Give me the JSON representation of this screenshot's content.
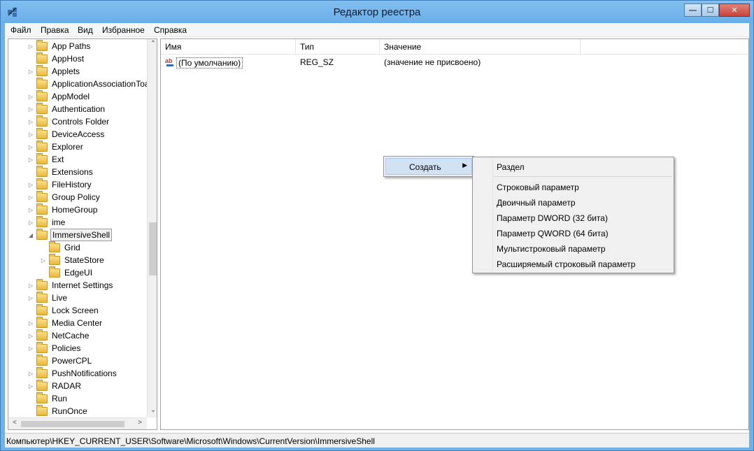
{
  "window": {
    "title": "Редактор реестра",
    "min_glyph": "—",
    "max_glyph": "☐",
    "close_glyph": "✕"
  },
  "menu": [
    "Файл",
    "Правка",
    "Вид",
    "Избранное",
    "Справка"
  ],
  "tree": {
    "items": [
      {
        "label": "App Paths",
        "expander": "▷",
        "level": 0
      },
      {
        "label": "AppHost",
        "expander": "",
        "level": 0
      },
      {
        "label": "Applets",
        "expander": "▷",
        "level": 0
      },
      {
        "label": "ApplicationAssociationToasts",
        "expander": "",
        "level": 0
      },
      {
        "label": "AppModel",
        "expander": "▷",
        "level": 0
      },
      {
        "label": "Authentication",
        "expander": "▷",
        "level": 0
      },
      {
        "label": "Controls Folder",
        "expander": "▷",
        "level": 0
      },
      {
        "label": "DeviceAccess",
        "expander": "▷",
        "level": 0
      },
      {
        "label": "Explorer",
        "expander": "▷",
        "level": 0
      },
      {
        "label": "Ext",
        "expander": "▷",
        "level": 0
      },
      {
        "label": "Extensions",
        "expander": "",
        "level": 0
      },
      {
        "label": "FileHistory",
        "expander": "▷",
        "level": 0
      },
      {
        "label": "Group Policy",
        "expander": "▷",
        "level": 0
      },
      {
        "label": "HomeGroup",
        "expander": "▷",
        "level": 0
      },
      {
        "label": "ime",
        "expander": "▷",
        "level": 0
      },
      {
        "label": "ImmersiveShell",
        "expander": "◢",
        "level": 0,
        "selected": true
      },
      {
        "label": "Grid",
        "expander": "",
        "level": 1
      },
      {
        "label": "StateStore",
        "expander": "▷",
        "level": 1
      },
      {
        "label": "EdgeUI",
        "expander": "",
        "level": 1
      },
      {
        "label": "Internet Settings",
        "expander": "▷",
        "level": 0
      },
      {
        "label": "Live",
        "expander": "▷",
        "level": 0
      },
      {
        "label": "Lock Screen",
        "expander": "",
        "level": 0
      },
      {
        "label": "Media Center",
        "expander": "▷",
        "level": 0
      },
      {
        "label": "NetCache",
        "expander": "▷",
        "level": 0
      },
      {
        "label": "Policies",
        "expander": "▷",
        "level": 0
      },
      {
        "label": "PowerCPL",
        "expander": "",
        "level": 0
      },
      {
        "label": "PushNotifications",
        "expander": "▷",
        "level": 0
      },
      {
        "label": "RADAR",
        "expander": "▷",
        "level": 0
      },
      {
        "label": "Run",
        "expander": "",
        "level": 0
      },
      {
        "label": "RunOnce",
        "expander": "",
        "level": 0
      }
    ],
    "scroll_up": "⌃",
    "scroll_down": "⌄",
    "scroll_left": "<",
    "scroll_right": ">"
  },
  "list": {
    "columns": [
      "Имя",
      "Тип",
      "Значение"
    ],
    "rows": [
      {
        "name": "(По умолчанию)",
        "type": "REG_SZ",
        "value": "(значение не присвоено)",
        "icon": "ab"
      }
    ]
  },
  "context_menu": {
    "create_label": "Создать",
    "create_arrow": "▶",
    "submenu": [
      "Раздел",
      "Строковый параметр",
      "Двоичный параметр",
      "Параметр DWORD (32 бита)",
      "Параметр QWORD (64 бита)",
      "Мультистроковый параметр",
      "Расширяемый строковый параметр"
    ]
  },
  "status": {
    "path": "Компьютер\\HKEY_CURRENT_USER\\Software\\Microsoft\\Windows\\CurrentVersion\\ImmersiveShell"
  }
}
